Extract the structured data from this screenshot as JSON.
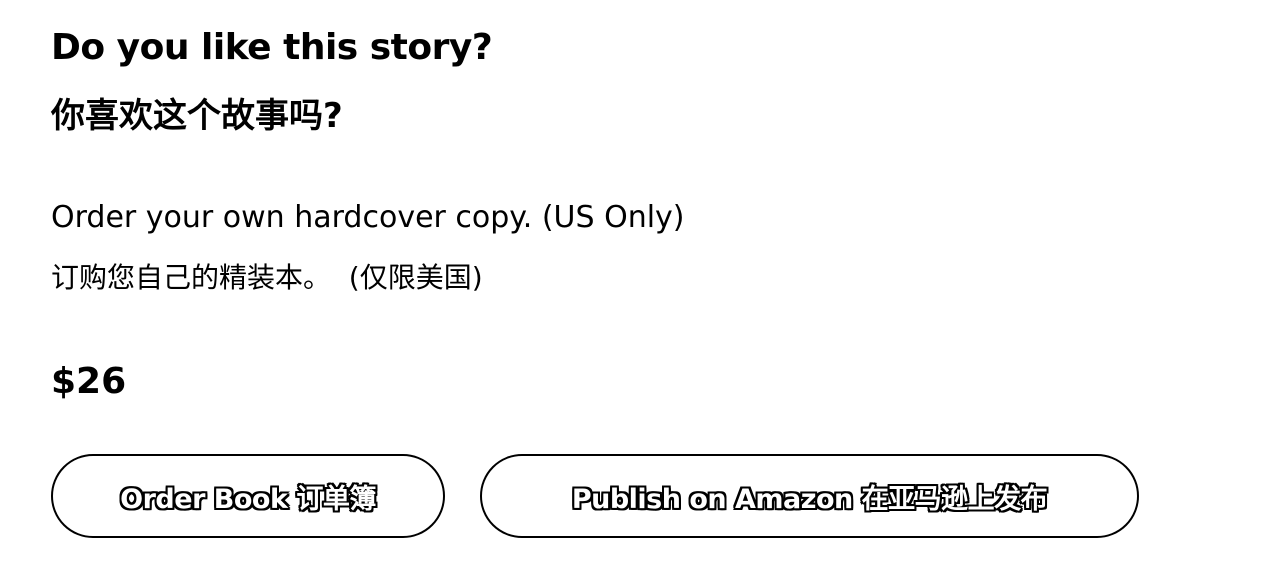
{
  "heading": {
    "en": "Do you like this story?",
    "zh": "你喜欢这个故事吗?"
  },
  "description": {
    "en": "Order your own hardcover copy. (US Only)",
    "zh": "订购您自己的精装本。  (仅限美国)"
  },
  "price": "$26",
  "buttons": {
    "order": "Order Book 订单簿",
    "publish": "Publish on Amazon 在亚马逊上发布"
  },
  "colors": {
    "text": "#000000",
    "background": "#ffffff",
    "button_border": "#000000"
  }
}
